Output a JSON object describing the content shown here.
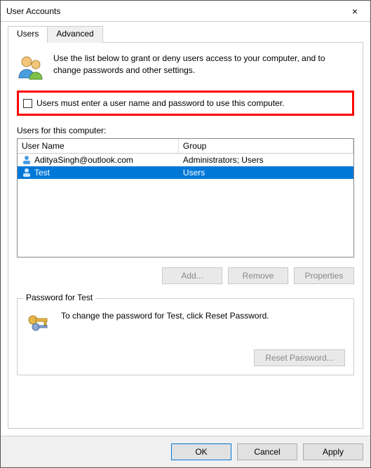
{
  "window": {
    "title": "User Accounts",
    "close_icon": "×"
  },
  "tabs": {
    "users": "Users",
    "advanced": "Advanced"
  },
  "intro_text": "Use the list below to grant or deny users access to your computer, and to change passwords and other settings.",
  "checkbox_label": "Users must enter a user name and password to use this computer.",
  "users_section_label": "Users for this computer:",
  "columns": {
    "name": "User Name",
    "group": "Group"
  },
  "users": [
    {
      "name": "AdityaSingh@outlook.com",
      "group": "Administrators; Users",
      "selected": false
    },
    {
      "name": "Test",
      "group": "Users",
      "selected": true
    }
  ],
  "buttons": {
    "add": "Add...",
    "remove": "Remove",
    "properties": "Properties",
    "reset_password": "Reset Password...",
    "ok": "OK",
    "cancel": "Cancel",
    "apply": "Apply"
  },
  "password_group": {
    "legend": "Password for Test",
    "text": "To change the password for Test, click Reset Password."
  }
}
